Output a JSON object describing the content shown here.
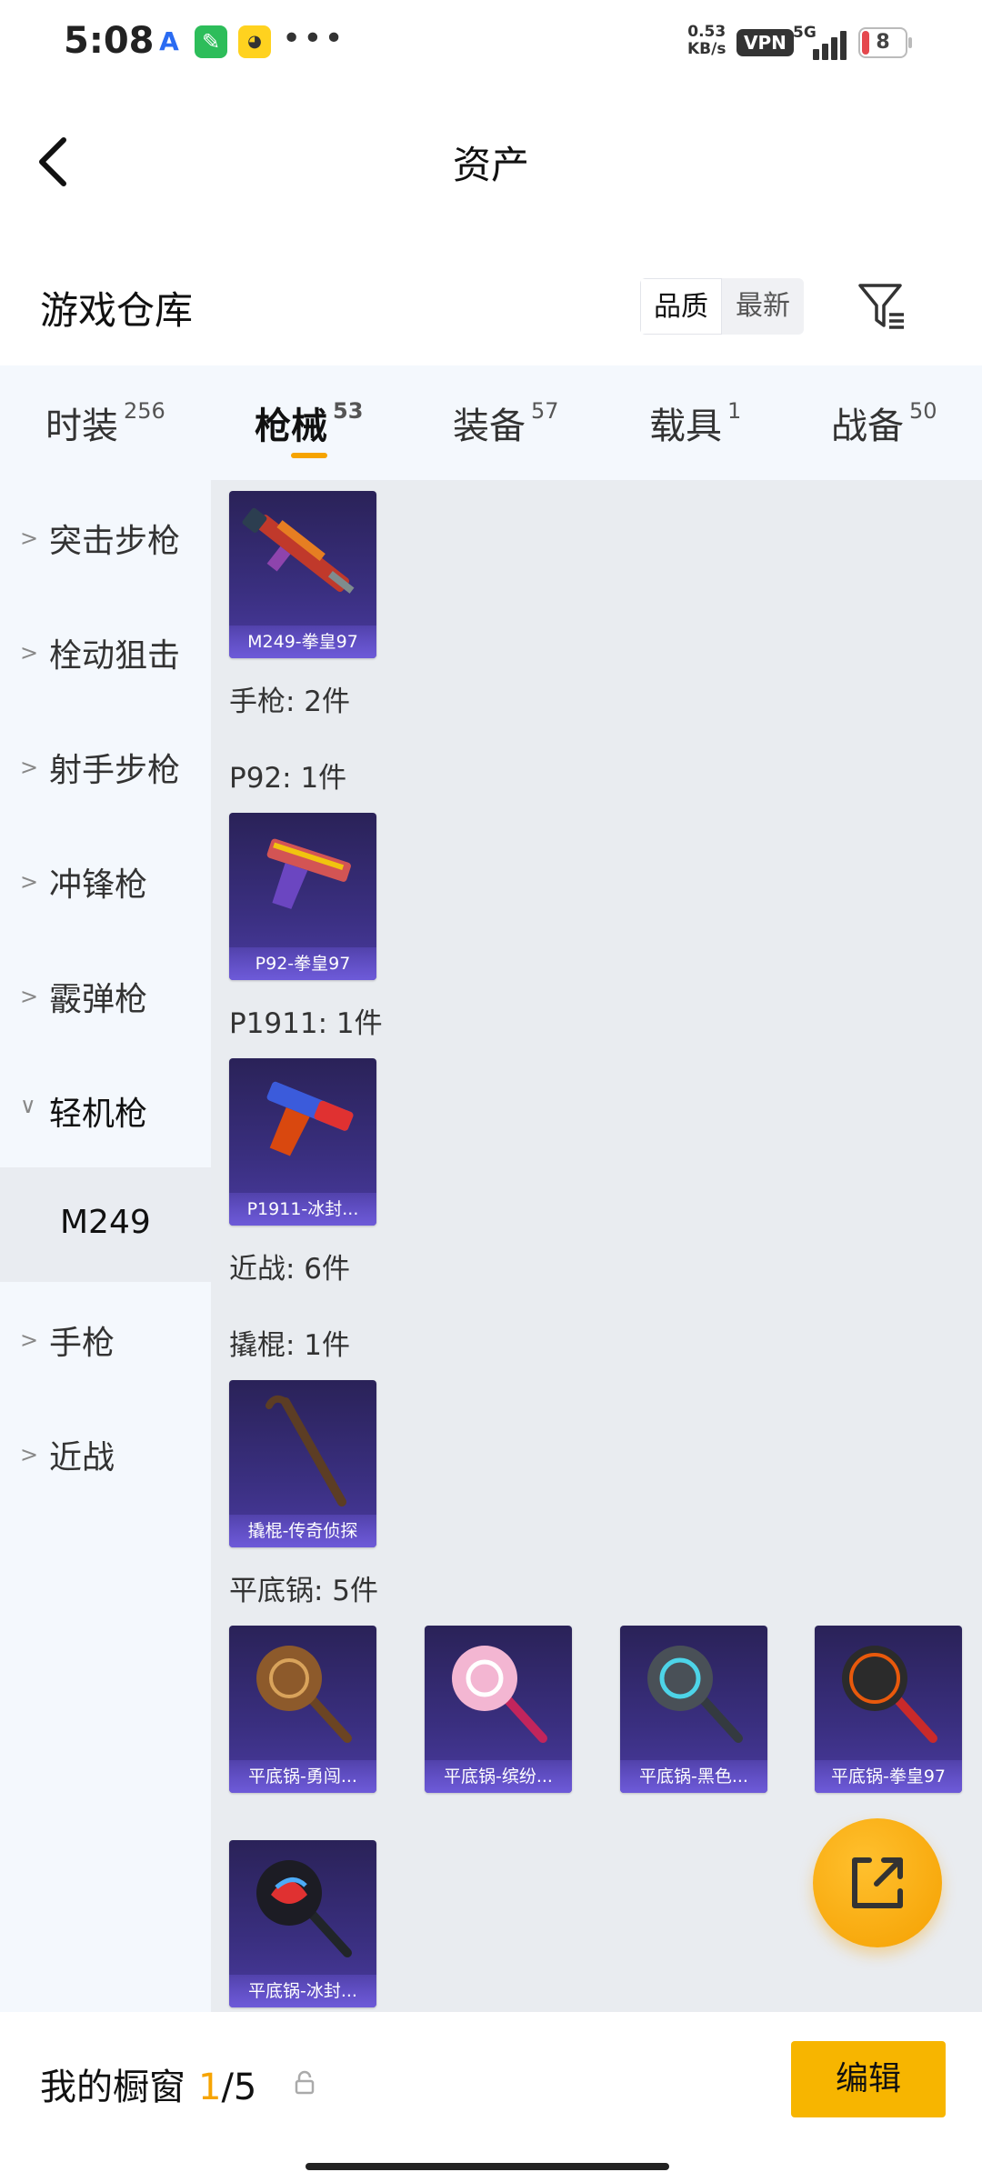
{
  "status_bar": {
    "time": "5:08",
    "net_speed_value": "0.53",
    "net_speed_unit": "KB/s",
    "vpn": "VPN",
    "network": "5G",
    "battery": "8",
    "dots": "•••"
  },
  "header": {
    "title": "资产"
  },
  "warehouse": {
    "title": "游戏仓库",
    "sort_options": [
      "品质",
      "最新"
    ],
    "selected_sort": "品质"
  },
  "tabs": [
    {
      "label": "时装",
      "count": "256"
    },
    {
      "label": "枪械",
      "count": "53"
    },
    {
      "label": "装备",
      "count": "57"
    },
    {
      "label": "载具",
      "count": "1"
    },
    {
      "label": "战备",
      "count": "50"
    }
  ],
  "active_tab": "枪械",
  "sidebar": {
    "items": [
      {
        "label": "突击步枪"
      },
      {
        "label": "栓动狙击"
      },
      {
        "label": "射手步枪"
      },
      {
        "label": "冲锋枪"
      },
      {
        "label": "霰弹枪"
      },
      {
        "label": "轻机枪"
      },
      {
        "label": "手枪"
      },
      {
        "label": "近战"
      }
    ],
    "expanded_item": "轻机枪",
    "selected_sub": "M249"
  },
  "content": {
    "groups": [
      {
        "label": "手枪: 2件"
      },
      {
        "label": "P92: 1件"
      },
      {
        "label": "P1911: 1件"
      },
      {
        "label": "近战: 6件"
      },
      {
        "label": "撬棍: 1件"
      },
      {
        "label": "平底锅: 5件"
      }
    ],
    "items": [
      {
        "name": "M249-拳皇97"
      },
      {
        "name": "P92-拳皇97"
      },
      {
        "name": "P1911-冰封..."
      },
      {
        "name": "撬棍-传奇侦探"
      },
      {
        "name": "平底锅-勇闯..."
      },
      {
        "name": "平底锅-缤纷..."
      },
      {
        "name": "平底锅-黑色..."
      },
      {
        "name": "平底锅-拳皇97"
      },
      {
        "name": "平底锅-冰封..."
      }
    ]
  },
  "bottom_bar": {
    "showcase_label": "我的橱窗",
    "current": "1",
    "total": "/5",
    "edit_label": "编辑"
  },
  "colors": {
    "accent": "#f6a400",
    "card_bg": "#3a2f80",
    "tab_bg": "#f4f8fd"
  }
}
